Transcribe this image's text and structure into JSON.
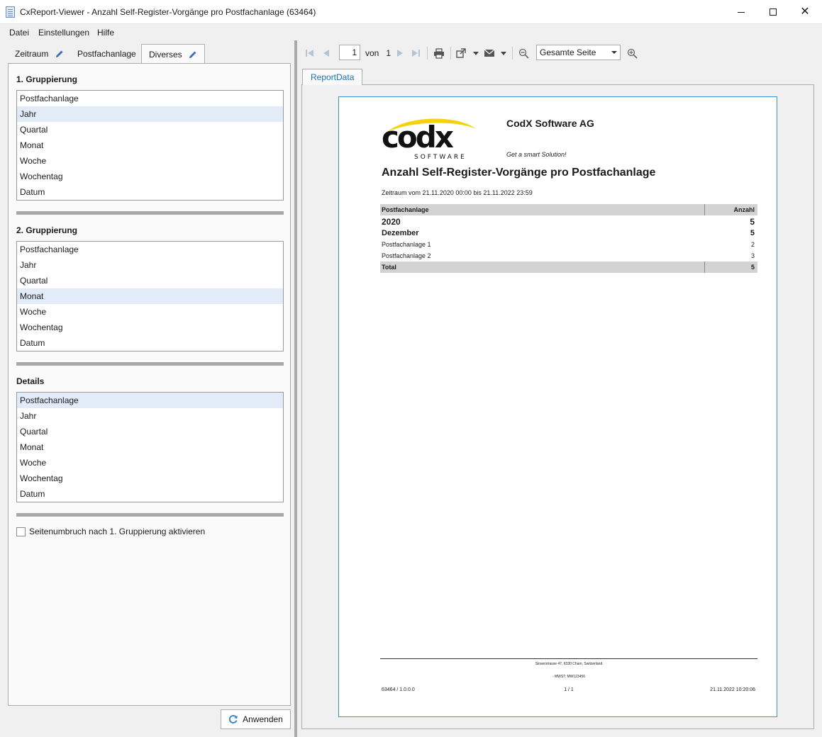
{
  "window": {
    "title": "CxReport-Viewer - Anzahl Self-Register-Vorgänge pro Postfachanlage (63464)"
  },
  "menu": [
    "Datei",
    "Einstellungen",
    "Hilfe"
  ],
  "left_tabs": [
    "Zeitraum",
    "Postfachanlage",
    "Diverses"
  ],
  "groups": [
    {
      "title": "1. Gruppierung",
      "items": [
        "Postfachanlage",
        "Jahr",
        "Quartal",
        "Monat",
        "Woche",
        "Wochentag",
        "Datum"
      ],
      "selected": "Jahr"
    },
    {
      "title": "2. Gruppierung",
      "items": [
        "Postfachanlage",
        "Jahr",
        "Quartal",
        "Monat",
        "Woche",
        "Wochentag",
        "Datum"
      ],
      "selected": "Monat"
    },
    {
      "title": "Details",
      "items": [
        "Postfachanlage",
        "Jahr",
        "Quartal",
        "Monat",
        "Woche",
        "Wochentag",
        "Datum"
      ],
      "selected": "Postfachanlage"
    }
  ],
  "page_break_checkbox": {
    "label": "Seitenumbruch nach 1. Gruppierung aktivieren",
    "checked": false
  },
  "apply_button": "Anwenden",
  "toolbar": {
    "page_value": "1",
    "page_of_label": "von",
    "page_total": "1",
    "zoom_value": "Gesamte Seite"
  },
  "report_tab": "ReportData",
  "report": {
    "logo_text": "codx",
    "logo_sub": "SOFTWARE",
    "company": "CodX Software AG",
    "slogan": "Get a smart Solution!",
    "title": "Anzahl Self-Register-Vorgänge pro Postfachanlage",
    "period": "Zeitraum vom 21.11.2020 00:00 bis 21.11.2022 23:59",
    "table": {
      "headers": [
        "Postfachanlage",
        "Anzahl"
      ],
      "rows": [
        {
          "kind": "year",
          "label": "2020",
          "value": "5"
        },
        {
          "kind": "month",
          "label": "Dezember",
          "value": "5"
        },
        {
          "kind": "detail",
          "label": "Postfachanlage 1",
          "value": "2"
        },
        {
          "kind": "detail",
          "label": "Postfachanlage 2",
          "value": "3"
        },
        {
          "kind": "total",
          "label": "Total",
          "value": "5"
        }
      ]
    },
    "footer": {
      "address": "Sinserstrasse 47, 6330 Cham, Switzerland",
      "vat": "- MWST: MW123456",
      "left": "63464 / 1.0.0.0",
      "middle": "1 / 1",
      "right": "21.11.2022 10:20:06"
    }
  },
  "colors": {
    "selection": "#e2ecf8",
    "accent_blue": "#1d6fb8",
    "logo_yellow": "#f5d20a"
  }
}
